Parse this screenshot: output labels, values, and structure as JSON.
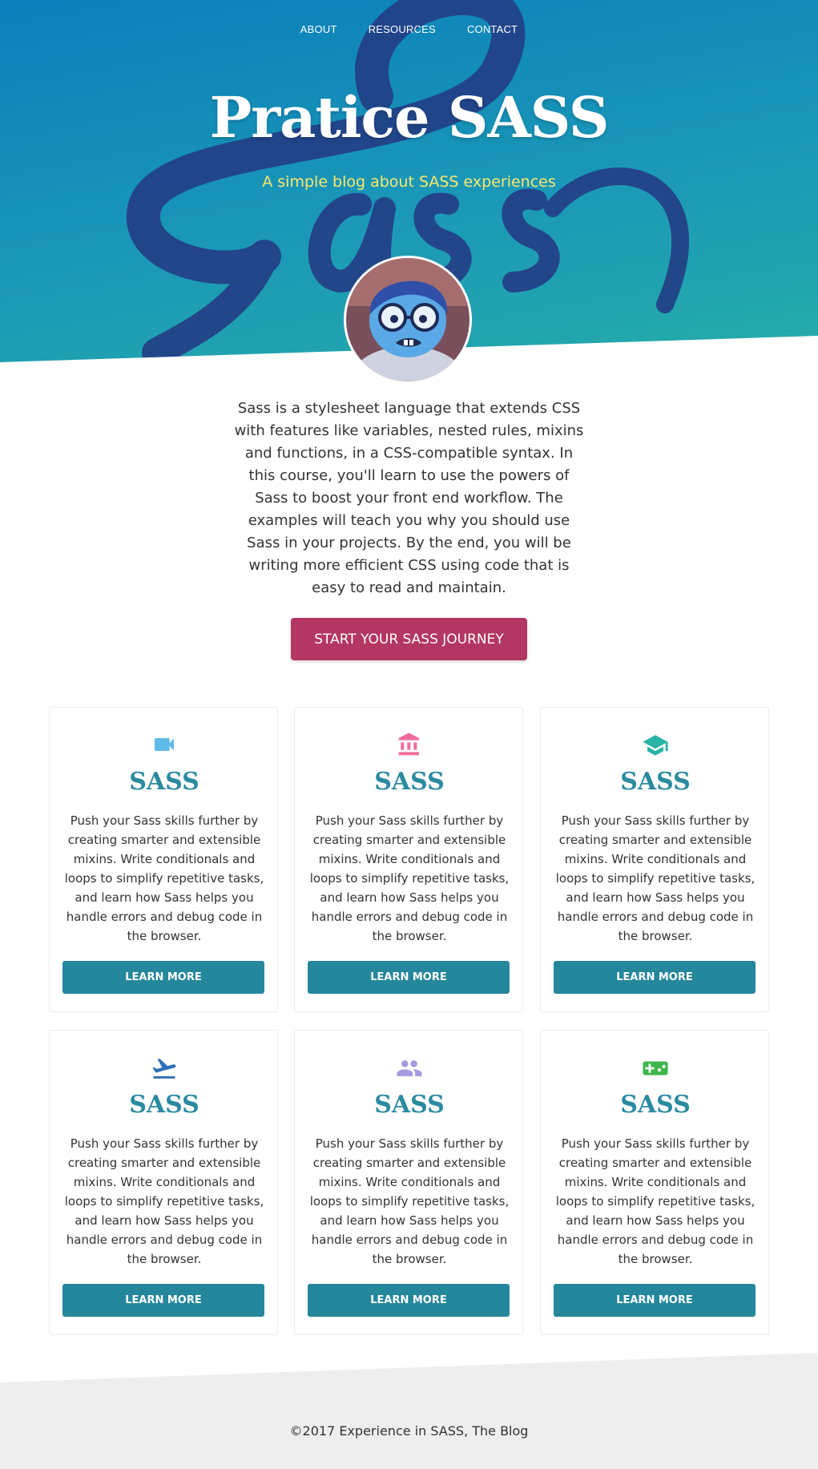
{
  "nav": {
    "items": [
      {
        "label": "ABOUT"
      },
      {
        "label": "RESOURCES"
      },
      {
        "label": "CONTACT"
      }
    ]
  },
  "hero": {
    "title": "Pratice SASS",
    "subtitle": "A simple blog about SASS experiences",
    "logo_text": "Sass"
  },
  "intro": {
    "text": "Sass is a stylesheet language that extends CSS with features like variables, nested rules, mixins and functions, in a CSS-compatible syntax. In this course, you'll learn to use the powers of Sass to boost your front end workflow. The examples will teach you why you should use Sass in your projects. By the end, you will be writing more efficient CSS using code that is easy to read and maintain.",
    "cta_label": "START YOUR SASS JOURNEY"
  },
  "cards": [
    {
      "icon": "video-camera-icon",
      "icon_color": "#5fbbe8",
      "title": "SASS",
      "text": "Push your Sass skills further by creating smarter and extensible mixins. Write conditionals and loops to simplify repetitive tasks, and learn how Sass helps you handle errors and debug code in the browser.",
      "button": "LEARN MORE"
    },
    {
      "icon": "bank-icon",
      "icon_color": "#f06b9c",
      "title": "SASS",
      "text": "Push your Sass skills further by creating smarter and extensible mixins. Write conditionals and loops to simplify repetitive tasks, and learn how Sass helps you handle errors and debug code in the browser.",
      "button": "LEARN MORE"
    },
    {
      "icon": "graduation-cap-icon",
      "icon_color": "#2ab3a6",
      "title": "SASS",
      "text": "Push your Sass skills further by creating smarter and extensible mixins. Write conditionals and loops to simplify repetitive tasks, and learn how Sass helps you handle errors and debug code in the browser.",
      "button": "LEARN MORE"
    },
    {
      "icon": "flight-takeoff-icon",
      "icon_color": "#2f6fb5",
      "title": "SASS",
      "text": "Push your Sass skills further by creating smarter and extensible mixins. Write conditionals and loops to simplify repetitive tasks, and learn how Sass helps you handle errors and debug code in the browser.",
      "button": "LEARN MORE"
    },
    {
      "icon": "people-icon",
      "icon_color": "#a79ae0",
      "title": "SASS",
      "text": "Push your Sass skills further by creating smarter and extensible mixins. Write conditionals and loops to simplify repetitive tasks, and learn how Sass helps you handle errors and debug code in the browser.",
      "button": "LEARN MORE"
    },
    {
      "icon": "gamepad-icon",
      "icon_color": "#3db54a",
      "title": "SASS",
      "text": "Push your Sass skills further by creating smarter and extensible mixins. Write conditionals and loops to simplify repetitive tasks, and learn how Sass helps you handle errors and debug code in the browser.",
      "button": "LEARN MORE"
    }
  ],
  "footer": {
    "text": "©2017 Experience in SASS, The Blog"
  },
  "colors": {
    "hero_gradient_start": "#0a7fbb",
    "hero_gradient_end": "#26aea8",
    "subtitle": "#f9e76a",
    "cta": "#b33663",
    "card_title": "#2a8aa0",
    "card_button": "#25879c",
    "footer_bg": "#eeeeee"
  }
}
